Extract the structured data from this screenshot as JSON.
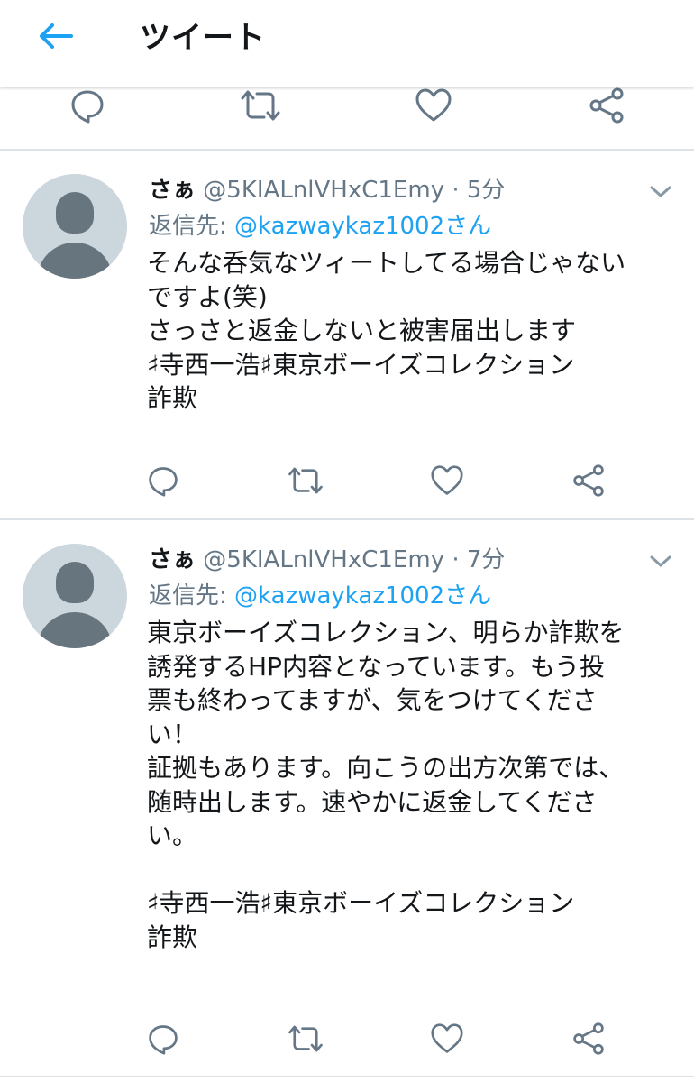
{
  "header": {
    "title": "ツイート"
  },
  "tweets": [
    {
      "name": "さぁ",
      "handle": "@5KIALnlVHxC1Emy",
      "separator": "·",
      "time": "5分",
      "reply_label": "返信先:",
      "reply_to": "@kazwaykaz1002さん",
      "lines": [
        "そんな呑気なツィートしてる場合じゃない",
        "ですよ(笑)",
        "さっさと返金しないと被害届出します",
        "♯寺西一浩♯東京ボーイズコレクション",
        "詐欺"
      ]
    },
    {
      "name": "さぁ",
      "handle": "@5KIALnlVHxC1Emy",
      "separator": "·",
      "time": "7分",
      "reply_label": "返信先:",
      "reply_to": "@kazwaykaz1002さん",
      "lines": [
        "東京ボーイズコレクション、明らか詐欺を",
        "誘発するHP内容となっています。もう投",
        "票も終わってますが、気をつけてくださ",
        "い！",
        "証拠もあります。向こうの出方次第では、",
        "随時出します。速やかに返金してくださ",
        "い。",
        "",
        "♯寺西一浩♯東京ボーイズコレクション",
        "詐欺"
      ]
    }
  ],
  "icons": {
    "back": "arrow-left-icon",
    "reply": "reply-icon",
    "retweet": "retweet-icon",
    "like": "heart-icon",
    "share": "share-icon",
    "more": "chevron-down-icon"
  },
  "colors": {
    "accent": "#1da1f2",
    "secondary_text": "#657786",
    "icon": "#657786",
    "avatar_bg": "#ccd6dd",
    "avatar_fg": "#67757f",
    "divider": "#dde2e6"
  }
}
